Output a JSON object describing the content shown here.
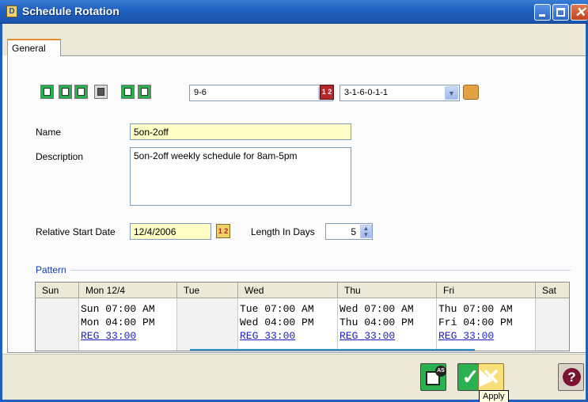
{
  "window": {
    "title": "Schedule Rotation"
  },
  "tabs": {
    "general": "General"
  },
  "toolbar": {
    "shift_value": "9-6",
    "pattern_value": "3-1-6-0-1-1",
    "calendar_icon_text": "1 2"
  },
  "form": {
    "name_label": "Name",
    "name_value": "5on-2off",
    "description_label": "Description",
    "description_value": "5on-2off weekly schedule for 8am-5pm",
    "start_date_label": "Relative Start Date",
    "start_date_value": "12/4/2006",
    "length_label": "Length In Days",
    "length_value": "5"
  },
  "pattern": {
    "group_label": "Pattern",
    "columns": [
      "Sun",
      "Mon 12/4",
      "Tue",
      "Wed",
      "Thu",
      "Fri",
      "Sat"
    ],
    "cells": [
      "",
      "Sun 07:00 AM\nMon 04:00 PM\n",
      "",
      "Tue 07:00 AM\nWed 04:00 PM\n",
      "Wed 07:00 AM\nThu 04:00 PM\n",
      "Thu 07:00 AM\nFri 04:00 PM\n",
      ""
    ],
    "reg_text": [
      "",
      "REG 33:00",
      "",
      "REG 33:00",
      "REG 33:00",
      "REG 33:00",
      ""
    ]
  },
  "buttons": {
    "save_as_badge": "AS",
    "apply_glyph": "✓",
    "cancel_glyph": "✕",
    "help_glyph": "?",
    "apply_tooltip": "Apply"
  },
  "colors": {
    "title_bar": "#1f5fbf",
    "required_field": "#ffffc6",
    "action_green": "#2bb14f",
    "cancel_yellow": "#f7e07a",
    "pattern_label": "#1a3eaa"
  }
}
